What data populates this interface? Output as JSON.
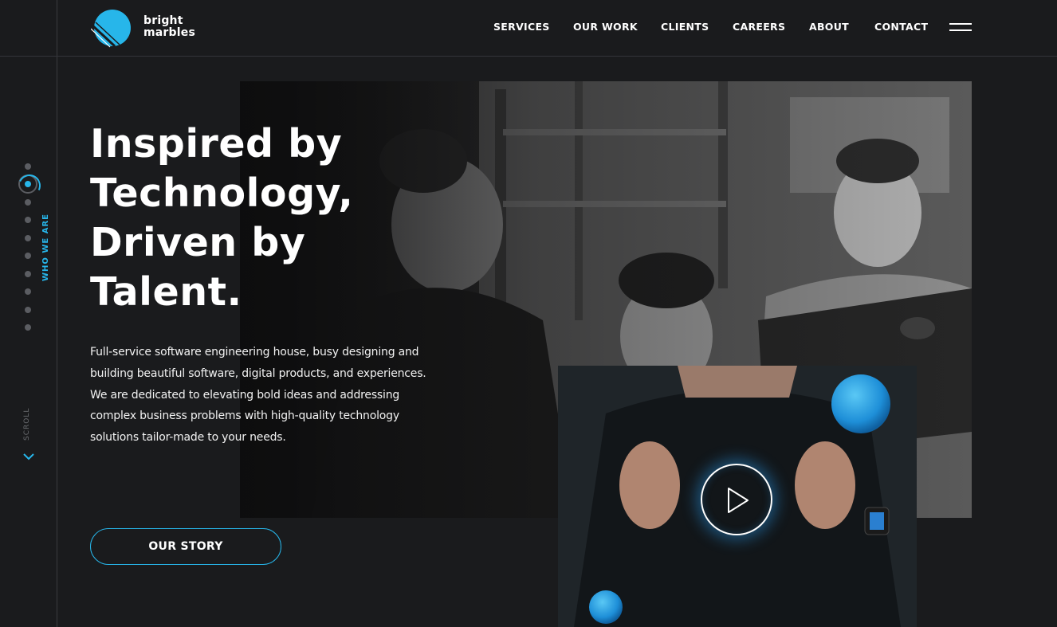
{
  "brand": {
    "line1": "bright",
    "line2": "marbles",
    "accent": "#27b6ea"
  },
  "nav": {
    "items": [
      {
        "label": "SERVICES"
      },
      {
        "label": "OUR WORK"
      },
      {
        "label": "CLIENTS"
      },
      {
        "label": "CAREERS"
      },
      {
        "label": "ABOUT"
      },
      {
        "label": "CONTACT"
      }
    ],
    "menu_icon": "hamburger-menu-icon"
  },
  "side_rail": {
    "section_label": "WHO WE ARE",
    "scroll_label": "SCROLL",
    "dot_count": 10,
    "active_dot": 2,
    "scroll_icon": "chevron-down-icon"
  },
  "hero": {
    "headline_lines": [
      "Inspired by",
      "Technology,",
      "Driven by",
      "Talent."
    ],
    "intro": "Full-service software engineering house, busy designing and building beautiful software, digital products, and experiences. We are dedicated to elevating bold ideas and addressing complex business problems with high-quality technology solutions tailor-made to your needs.",
    "cta_label": "OUR STORY"
  },
  "video": {
    "play_icon": "play-icon"
  },
  "colors": {
    "background": "#1a1b1d",
    "accent": "#27b6ea",
    "text": "#ffffff"
  }
}
